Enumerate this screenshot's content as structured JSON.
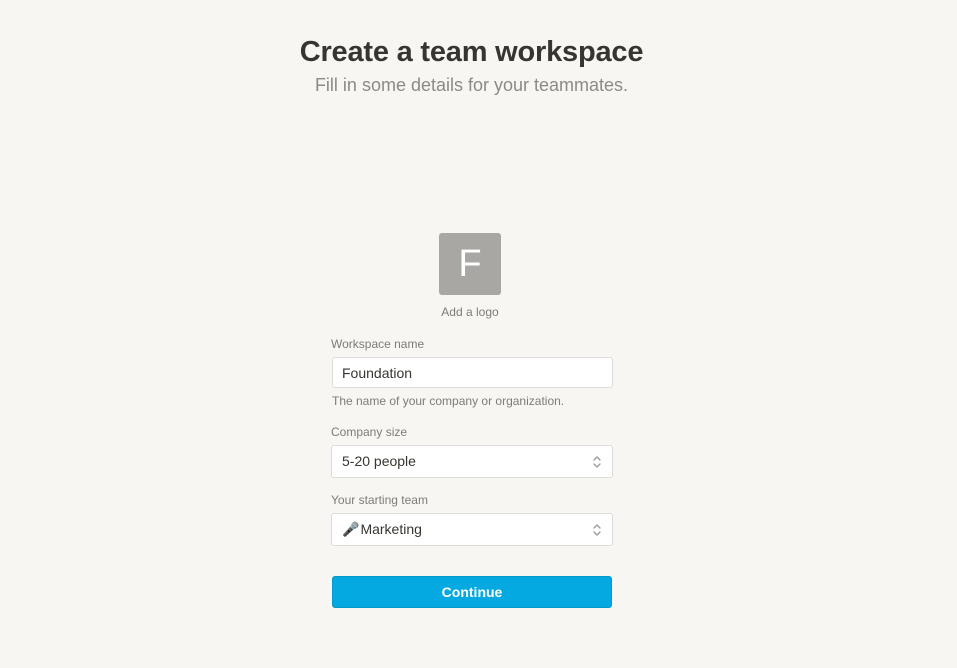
{
  "header": {
    "title": "Create a team workspace",
    "subtitle": "Fill in some details for your teammates."
  },
  "logo": {
    "letter": "F",
    "caption": "Add a logo"
  },
  "form": {
    "workspace_name": {
      "label": "Workspace name",
      "value": "Foundation",
      "hint": "The name of your company or organization."
    },
    "company_size": {
      "label": "Company size",
      "value": "5-20 people"
    },
    "starting_team": {
      "label": "Your starting team",
      "emoji": "🎤",
      "value": "Marketing"
    }
  },
  "actions": {
    "continue_label": "Continue"
  },
  "colors": {
    "background": "#f7f6f3",
    "accent": "#04a9e1",
    "logo_tile": "#a8a7a4"
  }
}
